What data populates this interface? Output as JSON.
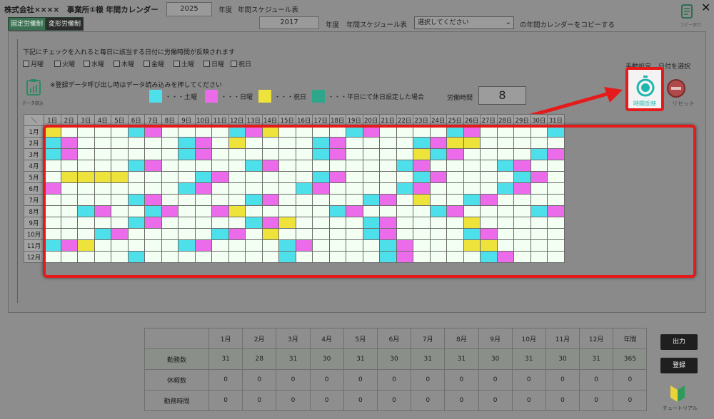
{
  "header": {
    "company": "株式会社××××　事業所①様 年間カレンダー",
    "year": "2025",
    "year_suffix": "年度",
    "schedule_title": "年間スケジュール表",
    "close": "✕"
  },
  "tabs": [
    {
      "label": "固定労働制"
    },
    {
      "label": "変形労働制"
    }
  ],
  "copy_row": {
    "year": "2017",
    "year_suffix": "年度",
    "schedule_title": "年間スケジュール表",
    "select_value": "選択してください",
    "suffix": "の年間カレンダーをコピーする"
  },
  "doc_icon_label": "コピー実行",
  "instruction": "下記にチェックを入れると毎日に該当する日付に労働時間が反映されます",
  "weekdays": [
    "月曜",
    "火曜",
    "水曜",
    "木曜",
    "金曜",
    "土曜",
    "日曜",
    "祝日"
  ],
  "note": "※登録データ呼び出し時はデータ読み込みを押してください",
  "data_load_label": "データ読込",
  "legend": [
    {
      "label": "・・・土曜",
      "color": "#4ee0ea"
    },
    {
      "label": "・・・日曜",
      "color": "#ec6bea"
    },
    {
      "label": "・・・祝日",
      "color": "#eee33a"
    },
    {
      "label": "・・・平日にて休日設定した場合",
      "color": "#2ea68a"
    }
  ],
  "hours_label": "労働時間",
  "hours_value": "8",
  "manual_label": "手動設定",
  "date_select_label": "日付を選択",
  "apply_label": "時間反映",
  "reset_label": "リセット",
  "calendar": {
    "corner": "＼",
    "days": [
      "1日",
      "2日",
      "3日",
      "4日",
      "5日",
      "6日",
      "7日",
      "8日",
      "9日",
      "10日",
      "11日",
      "12日",
      "13日",
      "14日",
      "15日",
      "16日",
      "17日",
      "18日",
      "19日",
      "20日",
      "21日",
      "22日",
      "23日",
      "24日",
      "25日",
      "26日",
      "27日",
      "28日",
      "29日",
      "30日",
      "31日"
    ],
    "months": [
      "1月",
      "2月",
      "3月",
      "4月",
      "5月",
      "6月",
      "7月",
      "8月",
      "9月",
      "10月",
      "11月",
      "12月"
    ],
    "cells": [
      "y....tm....tmy....tm....tm....tm",
      "tm......tm.y....tm....tmyy.....xxx",
      "tm......tm......tm....ytm....tmy",
      ".....tm.....tm.......tm....tm..y.x",
      ".yyyy....tm.....tm....tm....tm..t",
      "m.......tm.....tm....tm....tm...x",
      ".....tm.....tm.....tm.y..tm....tm",
      "..tm..tm..my.....tm....tm....tm.m",
      ".....tm.....tmy....tm....y.....tm..x",
      "...tm.....tm.y.....tm....tm......",
      "tmy.....tm....tm....tm...yy.......x",
      ".....t........t.....tm....tm...tm"
    ]
  },
  "summary": {
    "headers": [
      "",
      "1月",
      "2月",
      "3月",
      "4月",
      "5月",
      "6月",
      "7月",
      "8月",
      "9月",
      "10月",
      "11月",
      "12月",
      "年間"
    ],
    "rows": [
      {
        "label": "勤務数",
        "values": [
          "31",
          "28",
          "31",
          "30",
          "31",
          "30",
          "31",
          "31",
          "30",
          "31",
          "30",
          "31",
          "365"
        ]
      },
      {
        "label": "休暇数",
        "values": [
          "0",
          "0",
          "0",
          "0",
          "0",
          "0",
          "0",
          "0",
          "0",
          "0",
          "0",
          "0",
          "0"
        ]
      },
      {
        "label": "勤務時間",
        "values": [
          "0",
          "0",
          "0",
          "0",
          "0",
          "0",
          "0",
          "0",
          "0",
          "0",
          "0",
          "0",
          "0"
        ]
      }
    ]
  },
  "buttons": {
    "output": "出力",
    "register": "登録",
    "tutorial": "チュートリアル"
  }
}
